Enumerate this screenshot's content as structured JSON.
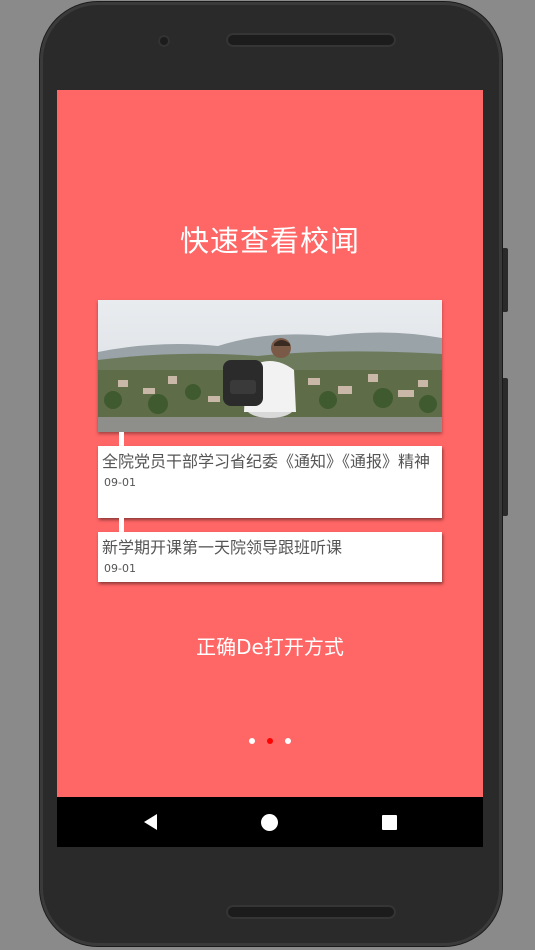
{
  "app": {
    "title": "快速查看校闻",
    "subtitle": "正确De打开方式",
    "background_color": "#ff6666"
  },
  "hero_image": {
    "description_icon": "photo-backpacker-overlooking-town"
  },
  "news": [
    {
      "title": "全院党员干部学习省纪委《通知》《通报》精神",
      "date": "09-01"
    },
    {
      "title": "新学期开课第一天院领导跟班听课",
      "date": "09-01"
    }
  ],
  "pager": {
    "count": 3,
    "active_index": 1,
    "active_color": "#ff0000",
    "inactive_color": "#ffffff"
  },
  "navbar": {
    "back_icon": "back-triangle-icon",
    "home_icon": "home-circle-icon",
    "recent_icon": "recents-square-icon"
  }
}
